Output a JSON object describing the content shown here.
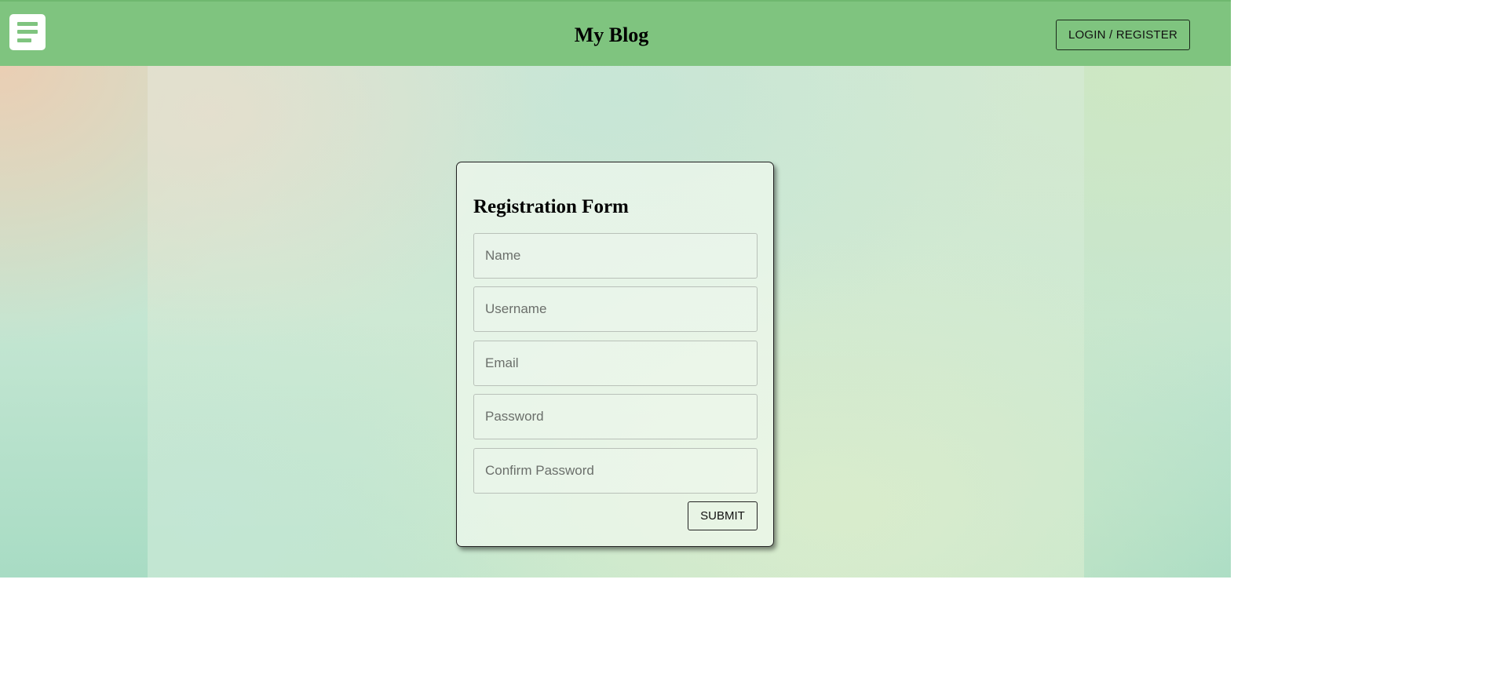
{
  "navbar": {
    "title": "My Blog",
    "login_label": "LOGIN / REGISTER",
    "menu_icon": "menu-icon",
    "background_color": "#7fc47f"
  },
  "form": {
    "title": "Registration Form",
    "fields": [
      {
        "name": "name",
        "placeholder": "Name",
        "value": ""
      },
      {
        "name": "username",
        "placeholder": "Username",
        "value": ""
      },
      {
        "name": "email",
        "placeholder": "Email",
        "value": ""
      },
      {
        "name": "password",
        "placeholder": "Password",
        "value": ""
      },
      {
        "name": "confirm_password",
        "placeholder": "Confirm Password",
        "value": ""
      }
    ],
    "submit_label": "SUBMIT"
  }
}
